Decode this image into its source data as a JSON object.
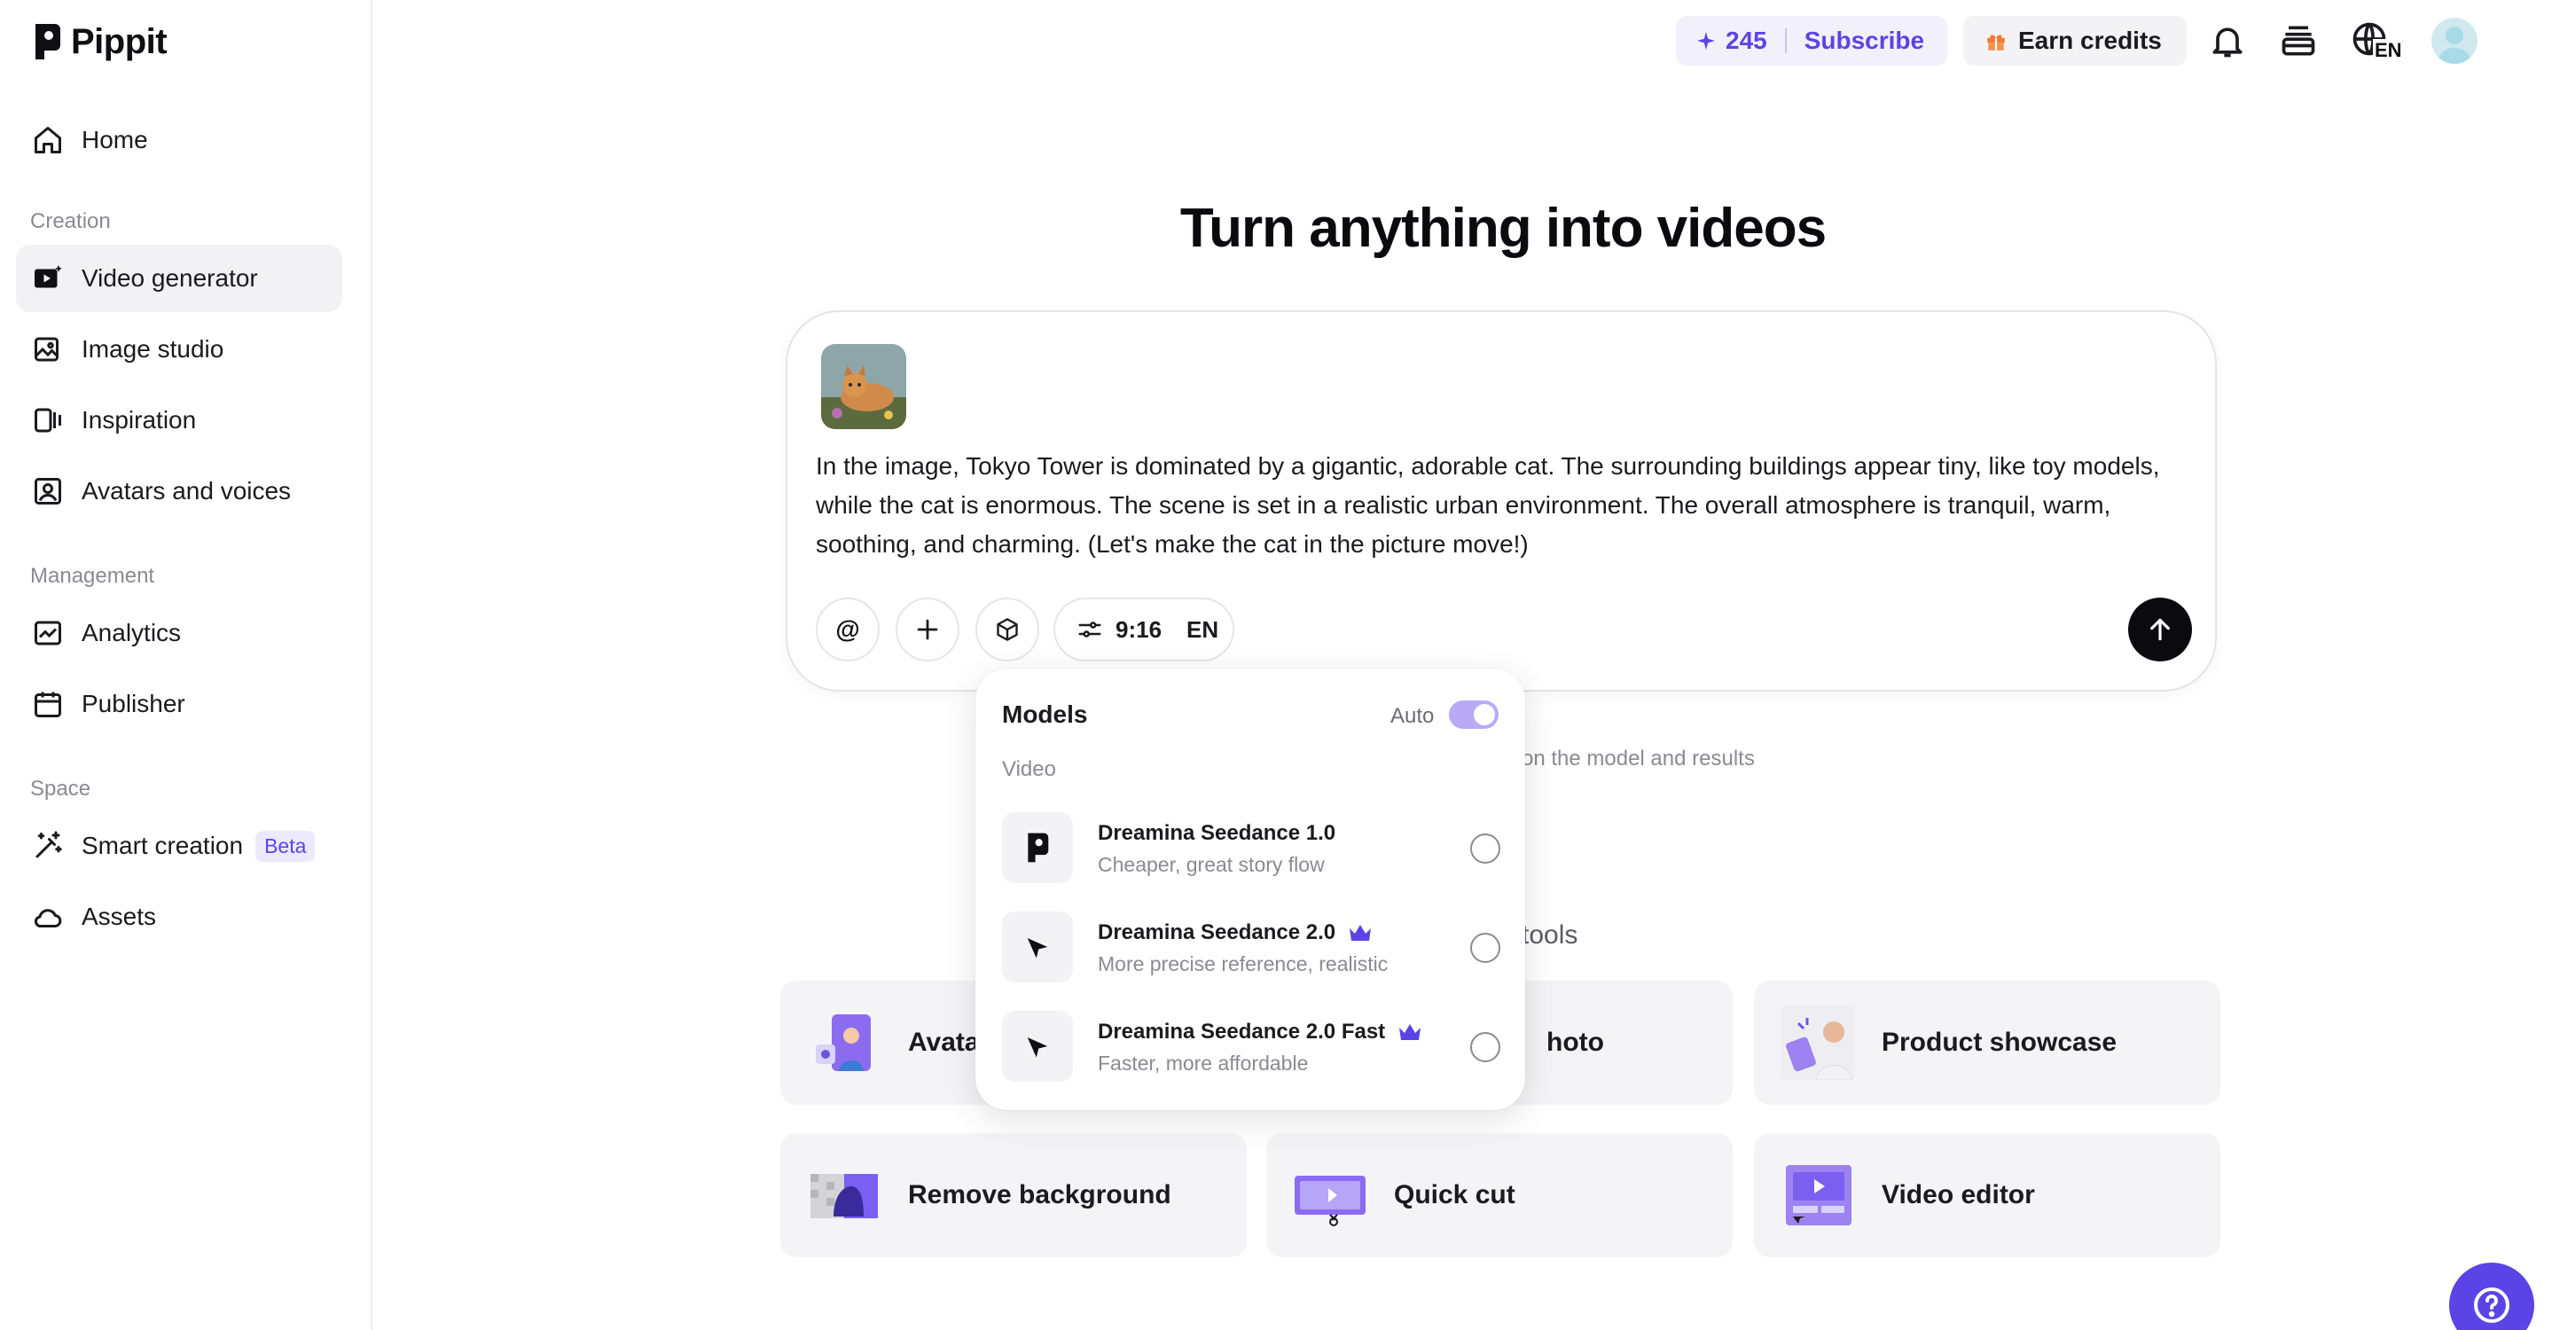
{
  "app": {
    "name": "Pippit"
  },
  "sidebar": {
    "home": "Home",
    "sections": {
      "creation": "Creation",
      "management": "Management",
      "space": "Space"
    },
    "items": [
      {
        "label": "Video generator",
        "icon": "video-generator-icon",
        "active": true
      },
      {
        "label": "Image studio",
        "icon": "image-studio-icon"
      },
      {
        "label": "Inspiration",
        "icon": "inspiration-icon"
      },
      {
        "label": "Avatars and voices",
        "icon": "avatar-icon"
      },
      {
        "label": "Analytics",
        "icon": "analytics-icon"
      },
      {
        "label": "Publisher",
        "icon": "calendar-icon"
      },
      {
        "label": "Smart creation",
        "icon": "magic-wand-icon",
        "badge": "Beta"
      },
      {
        "label": "Assets",
        "icon": "cloud-icon"
      }
    ]
  },
  "topbar": {
    "credits": "245",
    "subscribe": "Subscribe",
    "earn_credits": "Earn credits",
    "language": "EN"
  },
  "main": {
    "headline": "Turn anything into videos",
    "prompt": "In the image, Tokyo Tower is dominated by a gigantic, adorable cat. The surrounding buildings appear tiny, like toy models, while the cat is enormous. The scene is set in a realistic urban environment. The overall atmosphere is tranquil, warm, soothing, and charming. (Let's make the cat in the picture move!)",
    "aspect_ratio": "9:16",
    "language": "EN",
    "hint_partial": "on the model and results",
    "tools_heading_partial": "tools"
  },
  "tiles": [
    {
      "label": "Avata"
    },
    {
      "label": "hoto"
    },
    {
      "label": "Product showcase"
    },
    {
      "label": "Remove background"
    },
    {
      "label": "Quick cut"
    },
    {
      "label": "Video editor"
    }
  ],
  "models": {
    "title": "Models",
    "auto_label": "Auto",
    "auto_enabled": true,
    "category": "Video",
    "items": [
      {
        "name": "Dreamina Seedance 1.0",
        "desc": "Cheaper, great story flow",
        "premium": false
      },
      {
        "name": "Dreamina Seedance 2.0",
        "desc": "More precise reference, realistic",
        "premium": true
      },
      {
        "name": "Dreamina Seedance 2.0 Fast",
        "desc": "Faster, more affordable",
        "premium": true
      }
    ]
  },
  "colors": {
    "accent": "#5b44e6",
    "accent_soft": "#f1f0fb",
    "toggle": "#b9a9f7"
  }
}
